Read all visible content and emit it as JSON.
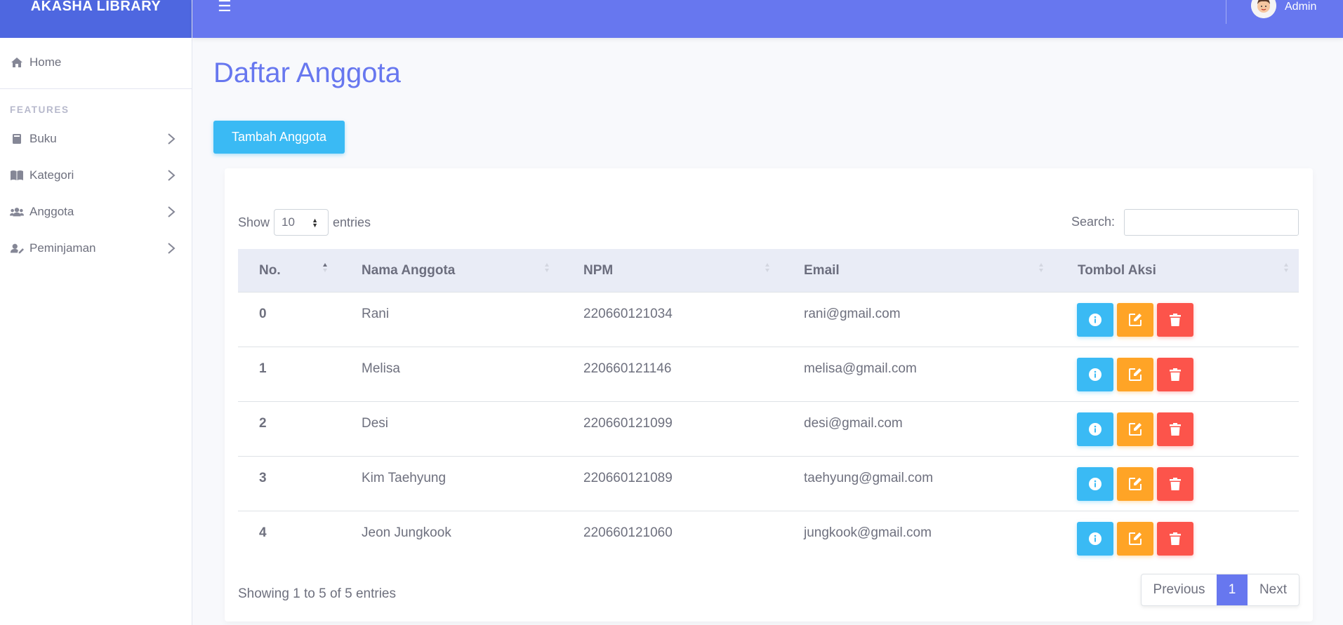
{
  "brand": "AKASHA LIBRARY",
  "topbar": {
    "user_name": "Admin"
  },
  "sidebar": {
    "home_label": "Home",
    "section_heading": "FEATURES",
    "items": [
      {
        "label": "Buku",
        "icon": "book-icon"
      },
      {
        "label": "Kategori",
        "icon": "open-book-icon"
      },
      {
        "label": "Anggota",
        "icon": "users-icon"
      },
      {
        "label": "Peminjaman",
        "icon": "user-edit-icon"
      }
    ]
  },
  "page": {
    "title": "Daftar Anggota",
    "add_button": "Tambah Anggota"
  },
  "table_controls": {
    "show_label": "Show",
    "entries_value": "10",
    "entries_label": "entries",
    "search_label": "Search:",
    "search_value": ""
  },
  "table": {
    "columns": [
      "No.",
      "Nama Anggota",
      "NPM",
      "Email",
      "Tombol Aksi"
    ],
    "rows": [
      {
        "no": "0",
        "nama": "Rani",
        "npm": "220660121034",
        "email": "rani@gmail.com"
      },
      {
        "no": "1",
        "nama": "Melisa",
        "npm": "220660121146",
        "email": "melisa@gmail.com"
      },
      {
        "no": "2",
        "nama": "Desi",
        "npm": "220660121099",
        "email": "desi@gmail.com"
      },
      {
        "no": "3",
        "nama": "Kim Taehyung",
        "npm": "220660121089",
        "email": "taehyung@gmail.com"
      },
      {
        "no": "4",
        "nama": "Jeon Jungkook",
        "npm": "220660121060",
        "email": "jungkook@gmail.com"
      }
    ]
  },
  "footer": {
    "showing": "Showing 1 to 5 of 5 entries",
    "prev": "Previous",
    "page": "1",
    "next": "Next"
  },
  "colors": {
    "primary": "#6777ef",
    "brand_bg": "#4e67e0",
    "info": "#3abaf4",
    "warning": "#ffa426",
    "danger": "#fc544b"
  }
}
